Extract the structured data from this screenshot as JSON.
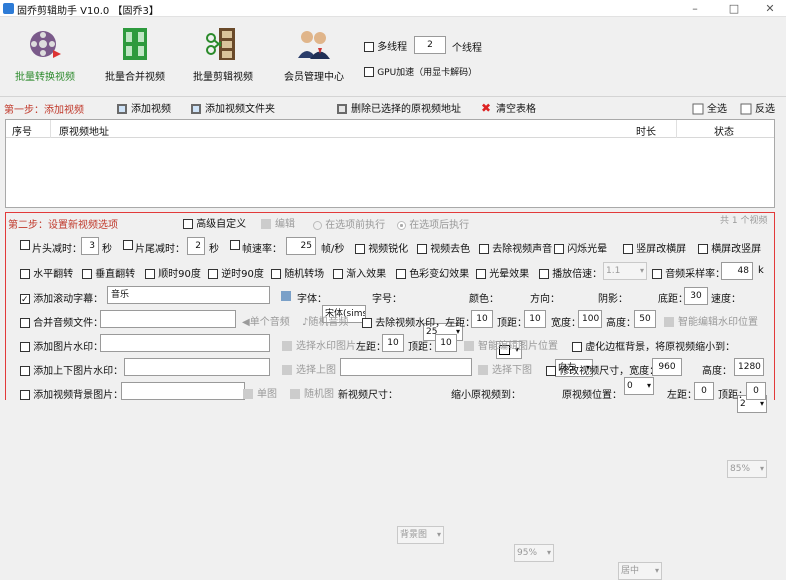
{
  "window": {
    "title": "固乔剪辑助手 V10.0 【固乔3】",
    "controls": {
      "minimize": "–",
      "maximize": "□",
      "close": "✕"
    }
  },
  "toolbar": {
    "batch_convert": "批量转换视频",
    "batch_merge": "批量合并视频",
    "batch_edit": "批量剪辑视频",
    "member_center": "会员管理中心"
  },
  "options": {
    "multithread_label": "多线程",
    "thread_count": "2",
    "thread_unit": "个线程",
    "gpu_label": "GPU加速（用显卡解码）"
  },
  "step1": {
    "label": "第一步：添加视频",
    "add_video": "添加视频",
    "add_folder": "添加视频文件夹",
    "delete_selected": "删除已选择的原视频地址",
    "clear_table": "清空表格",
    "select_all": "全选",
    "invert": "反选",
    "columns": [
      "序号",
      "原视频地址",
      "时长",
      "状态"
    ]
  },
  "step2": {
    "label": "第二步：设置新视频选项",
    "advanced": "高级自定义",
    "edit": "编辑",
    "run_before": "在选项前执行",
    "run_after": "在选项后执行",
    "count_text": "共 1 个视频"
  },
  "row1": {
    "head_cut": "片头减时：",
    "head_val": "3",
    "sec1": "秒",
    "tail_cut": "片尾减时：",
    "tail_val": "2",
    "sec2": "秒",
    "fps": "帧速率：",
    "fps_val": "25",
    "fps_unit": "帧/秒",
    "sharpen": "视频锐化",
    "decolor": "视频去色",
    "remove_audio": "去除视频声音",
    "flash": "闪烁光晕",
    "h2v": "竖屏改横屏",
    "v2h": "横屏改竖屏"
  },
  "row2": {
    "hflip": "水平翻转",
    "vflip": "垂直翻转",
    "rot90": "顺时90度",
    "rot_ccw90": "逆时90度",
    "random_transition": "随机转场",
    "fade_in": "渐入效果",
    "color_change": "色彩变幻效果",
    "glow": "光晕效果",
    "speed": "播放倍速：",
    "speed_val": "1.1",
    "sample_rate": "音频采样率：",
    "sample_val": "48",
    "sample_unit": "k"
  },
  "row3": {
    "subtitle": "添加滚动字幕：",
    "subtitle_val": "音乐",
    "font": "字体：",
    "font_val": "宋体(simsun)",
    "size": "字号：",
    "size_val": "25",
    "color": "颜色：",
    "direction": "方向：",
    "direction_val": "向左",
    "shadow": "阴影：",
    "shadow_val": "0",
    "bottom": "底距：",
    "bottom_val": "30",
    "speed": "速度：",
    "speed_val": "2"
  },
  "row4": {
    "merge_audio": "合并音频文件：",
    "single_audio": "单个音频",
    "random_audio": "随机音频",
    "remove_watermark": "去除视频水印，左距：",
    "left_val": "10",
    "top": "顶距：",
    "top_val": "10",
    "width": "宽度：",
    "width_val": "100",
    "height": "高度：",
    "height_val": "50",
    "smart_edit": "智能编辑水印位置"
  },
  "row5": {
    "image_watermark": "添加图片水印：",
    "choose_watermark": "选择水印图片",
    "left": "左距：",
    "left_val": "10",
    "top": "顶距：",
    "top_val": "10",
    "smart_edit": "智能编辑图片位置",
    "blur_border": "虚化边框背景，将原视频缩小到：",
    "blur_val": "85%"
  },
  "row6": {
    "tb_watermark": "添加上下图片水印：",
    "choose_top": "选择上图",
    "choose_bottom": "选择下图",
    "resize": "修改视频尺寸，宽度：",
    "width_val": "960",
    "height": "高度：",
    "height_val": "1280"
  },
  "row7": {
    "bg_image": "添加视频背景图片：",
    "single": "单图",
    "random": "随机图",
    "new_size": "新视频尺寸：",
    "new_size_val": "背景图",
    "shrink": "缩小原视频到：",
    "shrink_val": "95%",
    "position": "原视频位置：",
    "position_val": "居中",
    "left": "左距：",
    "left_val": "0",
    "top": "顶距：",
    "top_val": "0"
  },
  "colors": {
    "accent_red": "#e23a3a",
    "step_red": "#c0392b",
    "green": "#2e8b2e"
  }
}
